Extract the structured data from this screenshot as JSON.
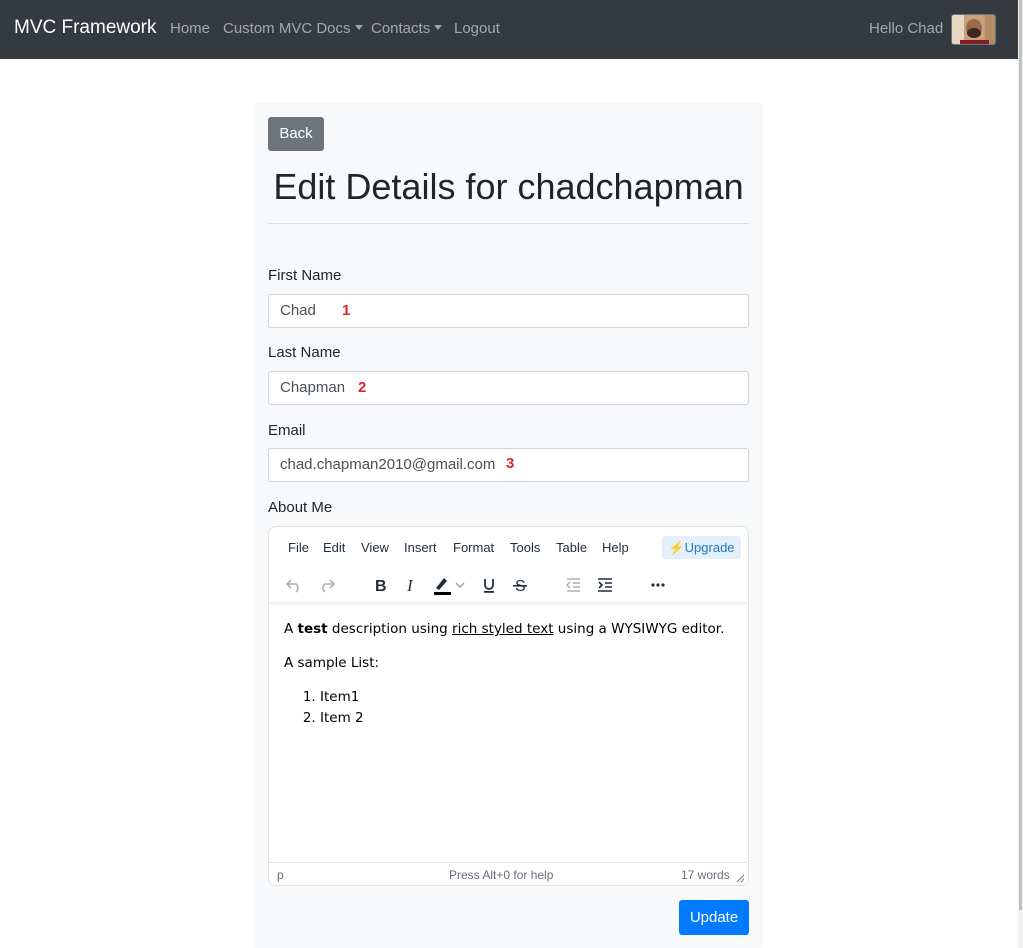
{
  "navbar": {
    "brand": "MVC Framework",
    "links": [
      "Home",
      "Custom MVC Docs",
      "Contacts",
      "Logout"
    ],
    "greeting": "Hello Chad"
  },
  "page": {
    "back_label": "Back",
    "title": "Edit Details for chadchapman",
    "update_label": "Update"
  },
  "form": {
    "first_name_label": "First Name",
    "first_name_value": "Chad",
    "last_name_label": "Last Name",
    "last_name_value": "Chapman",
    "email_label": "Email",
    "email_value": "chad.chapman2010@gmail.com",
    "about_label": "About Me",
    "markers": [
      "1",
      "2",
      "3"
    ]
  },
  "editor": {
    "menu": [
      "File",
      "Edit",
      "View",
      "Insert",
      "Format",
      "Tools",
      "Table",
      "Help"
    ],
    "upgrade_label": "⚡Upgrade",
    "content": {
      "p1_a": "A ",
      "p1_bold": "test",
      "p1_b": " description using ",
      "p1_underline": "rich styled text",
      "p1_c": " using a WYSIWYG editor.",
      "p2": "A sample List:",
      "list": [
        "Item1",
        "Item 2"
      ]
    },
    "status_path": "p",
    "status_help": "Press Alt+0 for help",
    "status_words": "17 words"
  },
  "colors": {
    "navbar_bg": "#343a40",
    "back_button": "#6c757d",
    "update_button": "#007bff",
    "marker": "#e0242b"
  }
}
